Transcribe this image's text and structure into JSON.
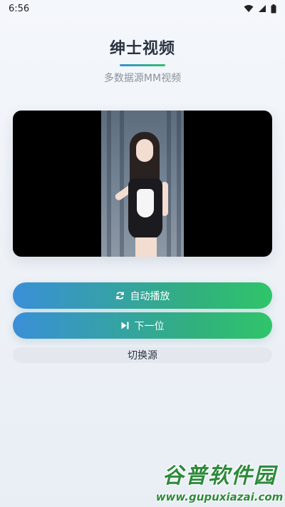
{
  "status_bar": {
    "time": "6:56",
    "icons": [
      "wifi-icon",
      "signal-icon",
      "battery-icon"
    ]
  },
  "header": {
    "title": "绅士视频",
    "subtitle": "多数据源MM视频"
  },
  "player": {
    "content": "video-frame"
  },
  "actions": {
    "auto_play": {
      "label": "自动播放",
      "icon": "refresh-icon"
    },
    "next": {
      "label": "下一位",
      "icon": "skip-next-icon"
    },
    "switch_source": {
      "label": "切换源"
    }
  },
  "watermark": {
    "line1": "谷普软件园",
    "line2": "www.gupuxiazai.com"
  },
  "colors": {
    "gradient_start": "#3a8fd8",
    "gradient_end": "#2fc56a",
    "title": "#2b3442",
    "subtitle": "#8a929c",
    "watermark": "#2f8a3c"
  }
}
